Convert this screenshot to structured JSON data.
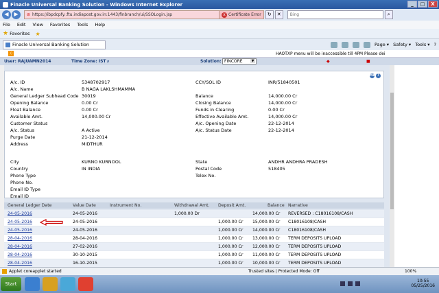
{
  "window": {
    "title": "Finacle Universal Banking Solution - Windows Internet Explorer",
    "min": "_",
    "max": "□",
    "close": "X"
  },
  "browser": {
    "back": "◀",
    "forward": "▶",
    "url": "https://ibpdcpfy..ftu.indiapost.gov.in:1443/finbranch/ui/SSOLogin.jsp",
    "cert_error": "Certificate Error",
    "search_placeholder": "Bing",
    "menu": [
      "File",
      "Edit",
      "View",
      "Favorites",
      "Tools",
      "Help"
    ],
    "favorites_label": "Favorites",
    "tab_label": "Finacle Universal Banking Solution",
    "commands": [
      "Page ▾",
      "Safety ▾",
      "Tools ▾"
    ],
    "help_icon": "?"
  },
  "app": {
    "notice": "HAOTXP menu will be inaccessible till 4PM Please dei",
    "user_label": "User: RAJUAMN2014",
    "timezone_label": "Time Zone: IST",
    "solution_label": "Solution:",
    "solution_value": "FINCORE",
    "help_label": "Help"
  },
  "details": {
    "acid_label": "A/c. ID",
    "acid_value": "5348702917",
    "ccy_label": "CCY/SOL ID",
    "ccy_value": "INR/51840501",
    "name_label": "A/c. Name",
    "name_value": "B NAGA LAKLSHMAMMA",
    "glsub_label": "General Ledger Subhead Code",
    "glsub_value": "30019",
    "balance_label": "Balance",
    "balance_value": "14,000.00 Cr",
    "opening_label": "Opening Balance",
    "opening_value": "0.00 Cr",
    "closing_label": "Closing Balance",
    "closing_value": "14,000.00 Cr",
    "float_label": "Float Balance",
    "float_value": "0.00 Cr",
    "funds_label": "Funds in Clearing",
    "funds_value": "0.00 Cr",
    "avail_label": "Available Amt.",
    "avail_value": "14,000.00 Cr",
    "effavail_label": "Effective Available Amt.",
    "effavail_value": "14,000.00 Cr",
    "custstatus_label": "Customer Status",
    "opendate_label": "A/c. Opening Date",
    "opendate_value": "22-12-2014",
    "acstatus_label": "A/c. Status",
    "acstatus_value": "A Active",
    "statusdate_label": "A/c. Status Date",
    "statusdate_value": "22-12-2014",
    "purge_label": "Purge Date",
    "purge_value": "21-12-2014",
    "address_label": "Address",
    "address_value": "MIDTHUR",
    "city_label": "City",
    "city_value": "KURNO KURNOOL",
    "state_label": "State",
    "state_value": "ANDHR ANDHRA PRADESH",
    "country_label": "Country",
    "country_value": "IN INDIA",
    "postal_label": "Postal Code",
    "postal_value": "518405",
    "phonetype_label": "Phone Type",
    "telex_label": "Telex No.",
    "phoneno_label": "Phone No.",
    "emailtype_label": "Email ID Type",
    "emailid_label": "Email ID"
  },
  "transactions": {
    "headers": [
      "General Ledger Date",
      "Value Date",
      "Instrument No.",
      "Withdrawal Amt.",
      "Deposit Amt.",
      "Balance",
      "Narrative"
    ],
    "rows": [
      {
        "gl": "24-05-2016",
        "value": "24-05-2016",
        "wd": "1,000.00 Dr",
        "dep": "",
        "bal": "14,000.00 Cr",
        "narr": "REVERSED : C18016108/CASH"
      },
      {
        "gl": "24-05-2016",
        "value": "24-05-2016",
        "wd": "",
        "dep": "1,000.00 Cr",
        "bal": "15,000.00 Cr",
        "narr": "C18016108/CASH"
      },
      {
        "gl": "24-05-2016",
        "value": "24-05-2016",
        "wd": "",
        "dep": "1,000.00 Cr",
        "bal": "14,000.00 Cr",
        "narr": "C18016108/CASH"
      },
      {
        "gl": "28-04-2016",
        "value": "28-04-2016",
        "wd": "",
        "dep": "1,000.00 Cr",
        "bal": "13,000.00 Cr",
        "narr": "TERM DEPOSITS UPLOAD"
      },
      {
        "gl": "28-04-2016",
        "value": "27-02-2016",
        "wd": "",
        "dep": "1,000.00 Cr",
        "bal": "12,000.00 Cr",
        "narr": "TERM DEPOSITS UPLOAD"
      },
      {
        "gl": "28-04-2016",
        "value": "30-10-2015",
        "wd": "",
        "dep": "1,000.00 Cr",
        "bal": "11,000.00 Cr",
        "narr": "TERM DEPOSITS UPLOAD"
      },
      {
        "gl": "28-04-2016",
        "value": "16-10-2015",
        "wd": "",
        "dep": "1,000.00 Cr",
        "bal": "10,000.00 Cr",
        "narr": "TERM DEPOSITS UPLOAD"
      }
    ]
  },
  "status": {
    "text": "Applet coreapplet started",
    "zone": "Trusted sites | Protected Mode: Off",
    "zoom": "100%"
  },
  "taskbar": {
    "start": "Start",
    "time": "10:55",
    "date": "05/25/2016"
  },
  "colors": {
    "accent": "#cc0000",
    "link": "#1a3a9c"
  }
}
